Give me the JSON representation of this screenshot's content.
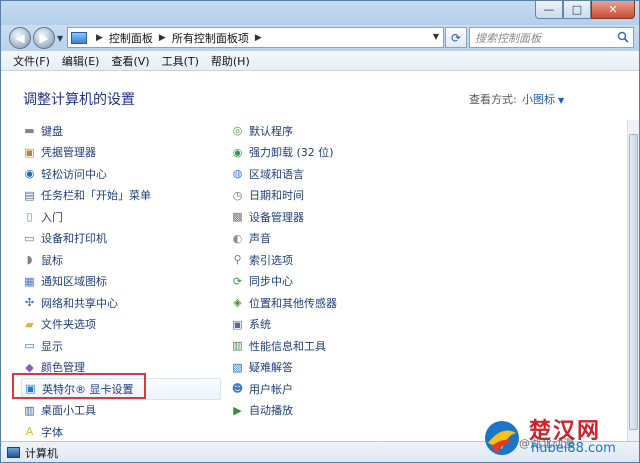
{
  "window": {
    "caption_buttons": {
      "minimize": "—",
      "maximize": "□",
      "close": "✕"
    }
  },
  "address_bar": {
    "crumbs": [
      "控制面板",
      "所有控制面板项"
    ],
    "search_placeholder": "搜索控制面板"
  },
  "menu": [
    "文件(F)",
    "编辑(E)",
    "查看(V)",
    "工具(T)",
    "帮助(H)"
  ],
  "header": {
    "title": "调整计算机的设置",
    "view_by_label": "查看方式:",
    "view_by_value": "小图标"
  },
  "items_left": [
    {
      "label": "键盘",
      "icon": "keyboard-icon"
    },
    {
      "label": "凭据管理器",
      "icon": "credential-manager-icon"
    },
    {
      "label": "轻松访问中心",
      "icon": "ease-of-access-icon"
    },
    {
      "label": "任务栏和「开始」菜单",
      "icon": "taskbar-icon"
    },
    {
      "label": "入门",
      "icon": "getting-started-icon"
    },
    {
      "label": "设备和打印机",
      "icon": "printer-icon"
    },
    {
      "label": "鼠标",
      "icon": "mouse-icon"
    },
    {
      "label": "通知区域图标",
      "icon": "notification-area-icon"
    },
    {
      "label": "网络和共享中心",
      "icon": "network-icon"
    },
    {
      "label": "文件夹选项",
      "icon": "folder-options-icon"
    },
    {
      "label": "显示",
      "icon": "display-icon"
    },
    {
      "label": "颜色管理",
      "icon": "color-management-icon"
    },
    {
      "label": "英特尔® 显卡设置",
      "icon": "intel-graphics-icon"
    },
    {
      "label": "桌面小工具",
      "icon": "gadgets-icon"
    },
    {
      "label": "字体",
      "icon": "fonts-icon"
    }
  ],
  "items_right": [
    {
      "label": "默认程序",
      "icon": "default-programs-icon"
    },
    {
      "label": "强力卸载 (32 位)",
      "icon": "uninstall-icon"
    },
    {
      "label": "区域和语言",
      "icon": "region-language-icon"
    },
    {
      "label": "日期和时间",
      "icon": "date-time-icon"
    },
    {
      "label": "设备管理器",
      "icon": "device-manager-icon"
    },
    {
      "label": "声音",
      "icon": "sound-icon"
    },
    {
      "label": "索引选项",
      "icon": "indexing-icon"
    },
    {
      "label": "同步中心",
      "icon": "sync-center-icon"
    },
    {
      "label": "位置和其他传感器",
      "icon": "location-sensors-icon"
    },
    {
      "label": "系统",
      "icon": "system-icon"
    },
    {
      "label": "性能信息和工具",
      "icon": "performance-icon"
    },
    {
      "label": "疑难解答",
      "icon": "troubleshooting-icon"
    },
    {
      "label": "用户帐户",
      "icon": "user-accounts-icon"
    },
    {
      "label": "自动播放",
      "icon": "autoplay-icon"
    }
  ],
  "status_bar": {
    "text": "计算机"
  },
  "watermark": {
    "brand": "楚汉网",
    "url": "hubei88.com",
    "signature": "@湖北动漫"
  },
  "colors": {
    "accent": "#1e3287",
    "link": "#1f3f7a",
    "highlight": "#d83a3a"
  }
}
